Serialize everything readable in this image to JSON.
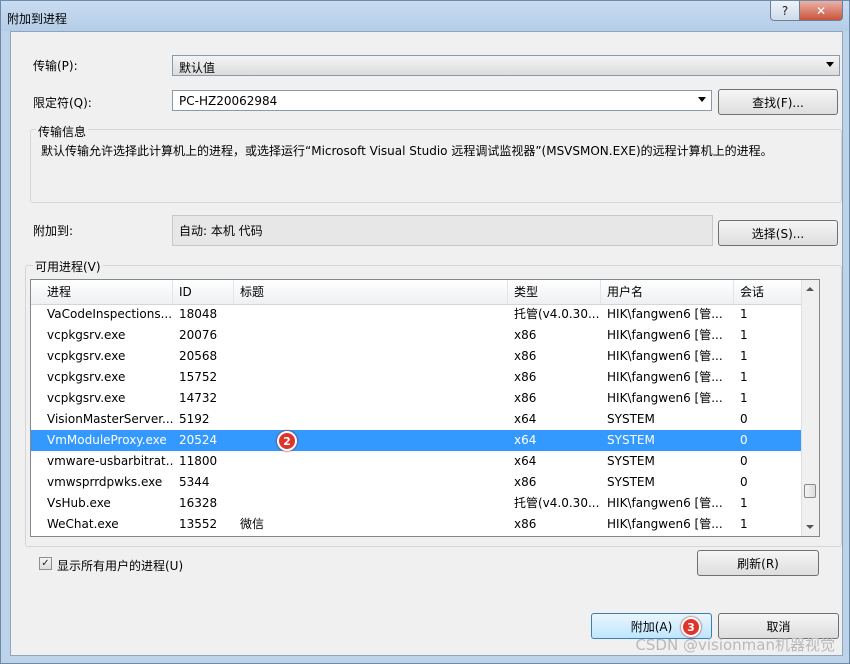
{
  "window": {
    "title": "附加到进程",
    "help_glyph": "?",
    "close_glyph": "✕"
  },
  "transport": {
    "label": "传输(P):",
    "value": "默认值"
  },
  "qualifier": {
    "label": "限定符(Q):",
    "value": "PC-HZ20062984",
    "find_button": "查找(F)..."
  },
  "transport_info": {
    "title": "传输信息",
    "text": "默认传输允许选择此计算机上的进程，或选择运行“Microsoft Visual Studio 远程调试监视器”(MSVSMON.EXE)的远程计算机上的进程。"
  },
  "attach_to": {
    "label": "附加到:",
    "value": "自动: 本机 代码",
    "select_button": "选择(S)..."
  },
  "processes": {
    "group_label": "可用进程(V)",
    "columns": [
      "进程",
      "ID",
      "标题",
      "类型",
      "用户名",
      "会话"
    ],
    "rows": [
      [
        "VaCodeInspections...",
        "18048",
        "",
        "托管(v4.0.30...",
        "HIK\\fangwen6 [管...",
        "1"
      ],
      [
        "vcpkgsrv.exe",
        "20076",
        "",
        "x86",
        "HIK\\fangwen6 [管...",
        "1"
      ],
      [
        "vcpkgsrv.exe",
        "20568",
        "",
        "x86",
        "HIK\\fangwen6 [管...",
        "1"
      ],
      [
        "vcpkgsrv.exe",
        "15752",
        "",
        "x86",
        "HIK\\fangwen6 [管...",
        "1"
      ],
      [
        "vcpkgsrv.exe",
        "14732",
        "",
        "x86",
        "HIK\\fangwen6 [管...",
        "1"
      ],
      [
        "VisionMasterServer...",
        "5192",
        "",
        "x64",
        "SYSTEM",
        "0"
      ],
      [
        "VmModuleProxy.exe",
        "20524",
        "",
        "x64",
        "SYSTEM",
        "0"
      ],
      [
        "vmware-usbarbitrat...",
        "11800",
        "",
        "x64",
        "SYSTEM",
        "0"
      ],
      [
        "vmwsprrdpwks.exe",
        "5344",
        "",
        "x86",
        "SYSTEM",
        "0"
      ],
      [
        "VsHub.exe",
        "16328",
        "",
        "托管(v4.0.30...",
        "HIK\\fangwen6 [管...",
        "1"
      ],
      [
        "WeChat.exe",
        "13552",
        "微信",
        "x86",
        "HIK\\fangwen6 [管...",
        "1"
      ]
    ],
    "selected_row": 6
  },
  "show_all_users": {
    "label": "显示所有用户的进程(U)",
    "checked": true,
    "check_glyph": "✓"
  },
  "refresh_button": "刷新(R)",
  "attach_button": "附加(A)",
  "cancel_button": "取消",
  "badges": {
    "step2": "2",
    "step3": "3"
  },
  "watermark": "CSDN @visionman机器视觉",
  "colors": {
    "selection": "#3399ff",
    "badge": "#e0332a"
  }
}
